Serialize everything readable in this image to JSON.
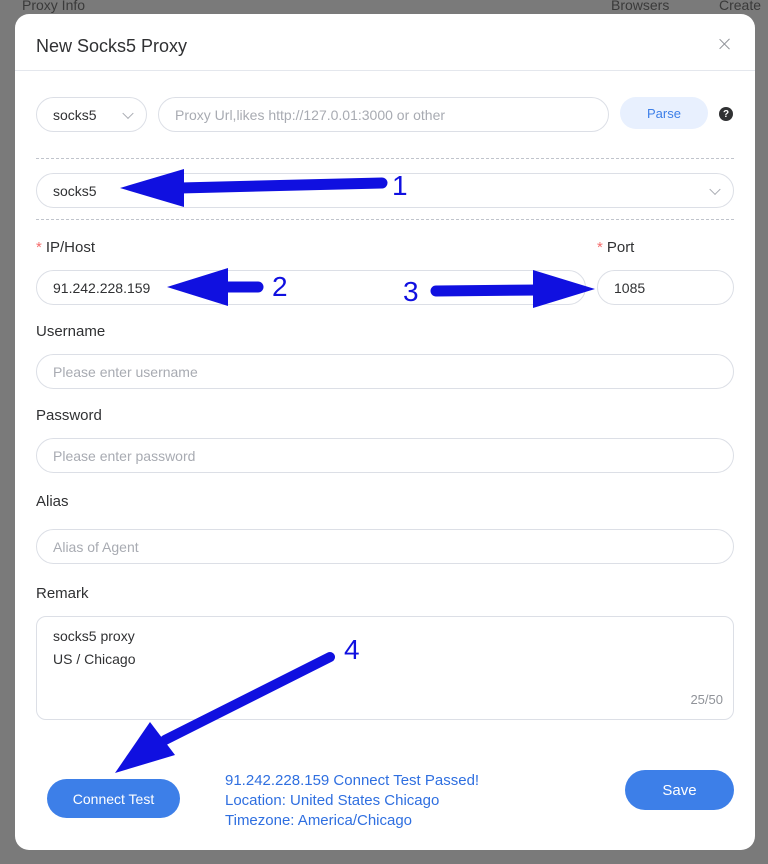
{
  "background": {
    "left_label": "Proxy Info",
    "right_labels": [
      "Browsers",
      "Create"
    ]
  },
  "dialog": {
    "title": "New Socks5 Proxy"
  },
  "parse_row": {
    "protocol": "socks5",
    "url_placeholder": "Proxy Url,likes http://127.0.01:3000 or other",
    "parse_label": "Parse",
    "help_glyph": "?"
  },
  "protocol_select": {
    "value": "socks5"
  },
  "fields": {
    "host_label": "IP/Host",
    "host_value": "91.242.228.159",
    "port_label": "Port",
    "port_value": "1085",
    "username_label": "Username",
    "username_placeholder": "Please enter username",
    "password_label": "Password",
    "password_placeholder": "Please enter password",
    "alias_label": "Alias",
    "alias_placeholder": "Alias of Agent",
    "remark_label": "Remark",
    "remark_lines": [
      "socks5 proxy",
      "US / Chicago"
    ],
    "remark_count": "25/50",
    "required_mark": "*"
  },
  "actions": {
    "connect_test": "Connect Test",
    "save": "Save"
  },
  "result": {
    "line1": "91.242.228.159 Connect Test Passed!",
    "line2": "Location: United States Chicago",
    "line3": "Timezone: America/Chicago"
  },
  "annotations": {
    "n1": "1",
    "n2": "2",
    "n3": "3",
    "n4": "4",
    "color": "#1010e0"
  },
  "colors": {
    "primary": "#3d7fe8",
    "required": "#f56c6c",
    "result_text": "#2f6fe0"
  }
}
